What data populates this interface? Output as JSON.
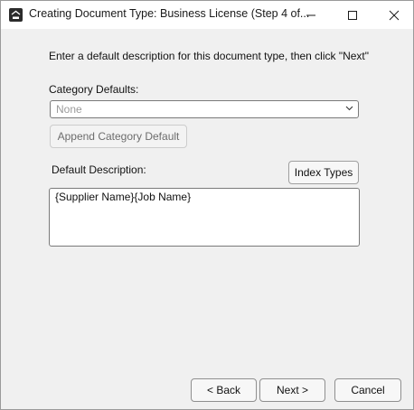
{
  "window": {
    "title": "Creating Document Type: Business License (Step 4 of..."
  },
  "content": {
    "instruction": "Enter a default description for this document type, then click \"Next\"",
    "category_label": "Category Defaults:",
    "category_value": "None",
    "append_button": "Append Category Default",
    "description_label": "Default Description:",
    "index_types_button": "Index Types",
    "description_value": "{Supplier Name}{Job Name}"
  },
  "footer": {
    "back": "< Back",
    "next": "Next >",
    "cancel": "Cancel"
  },
  "icons": {
    "app": "app-logo-icon",
    "minimize": "minimize-icon",
    "maximize": "maximize-icon",
    "close": "close-icon",
    "dropdown": "chevron-down-icon"
  }
}
